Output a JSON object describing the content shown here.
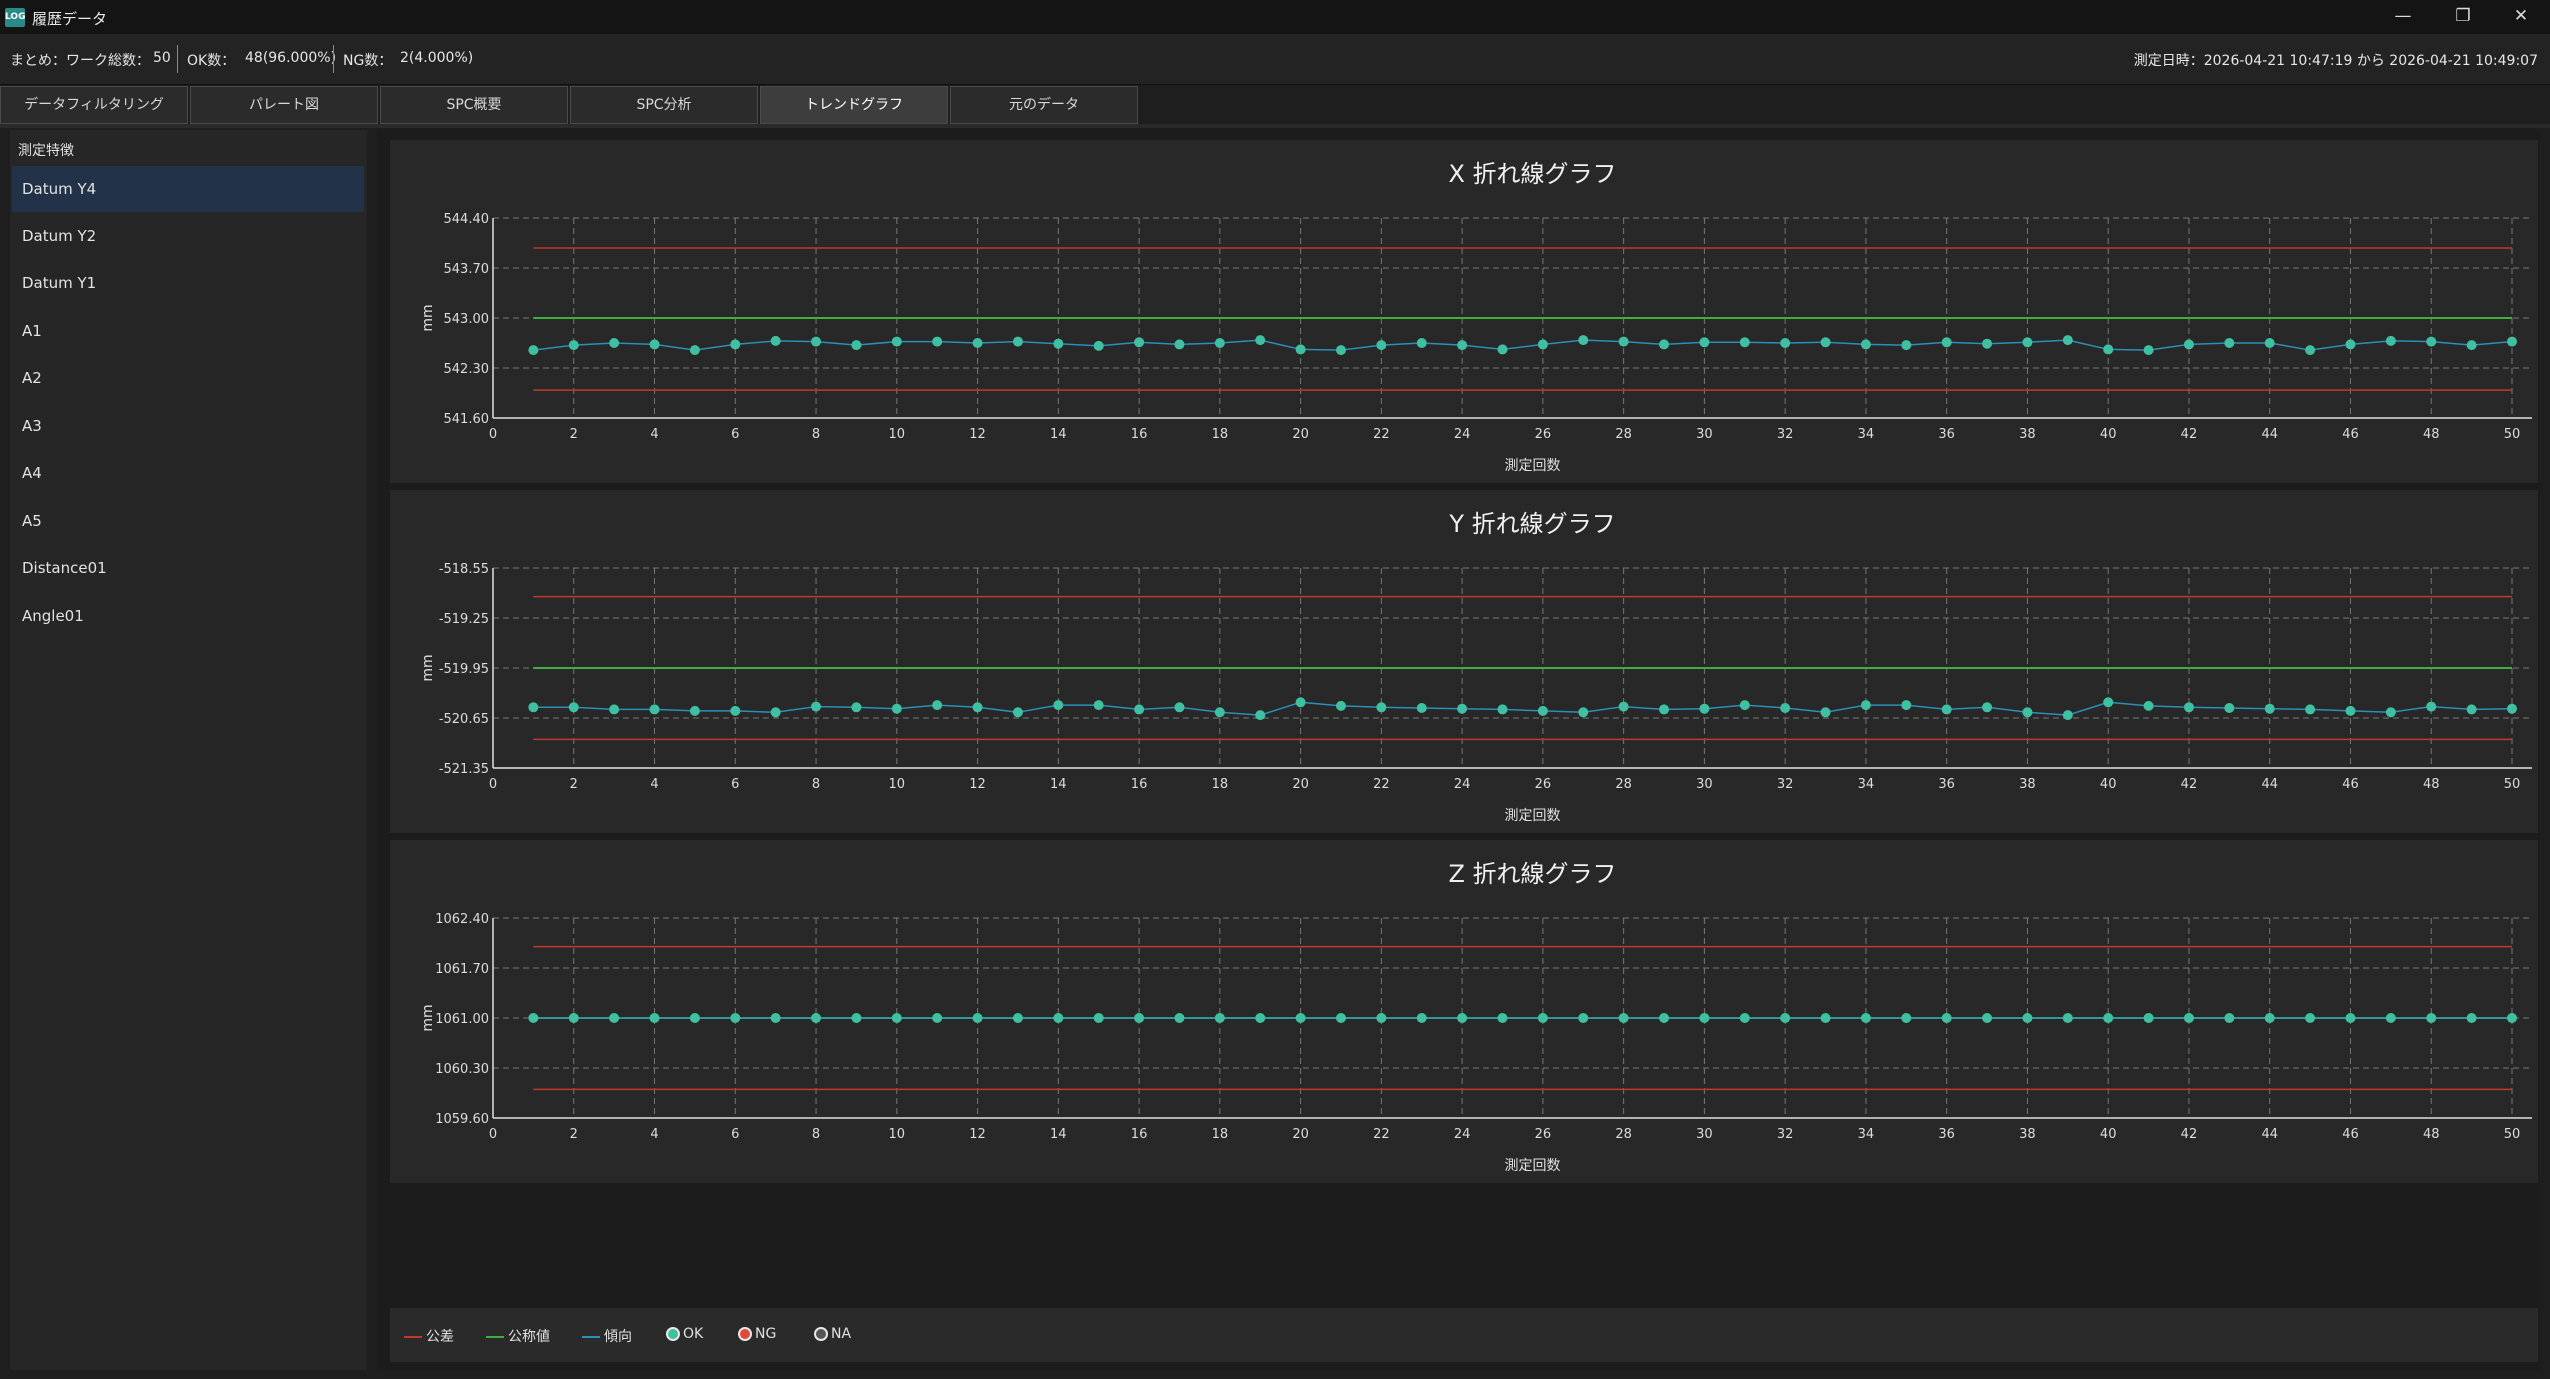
{
  "window": {
    "title": "履歴データ",
    "icon_label": "LOG",
    "min_icon": "minimize-icon",
    "restore_icon": "restore-icon",
    "close_icon": "close-icon"
  },
  "summary": {
    "prefix": "まとめ：",
    "total_label": "ワーク総数：",
    "total_value": "50",
    "ok_label": "OK数：",
    "ok_value": "48(96.000%)",
    "ng_label": "NG数：",
    "ng_value": "2(4.000%)",
    "datetime_text": "測定日時：2026-04-21 10:47:19 から 2026-04-21 10:49:07"
  },
  "tabs": [
    {
      "label": "データフィルタリング",
      "active": false
    },
    {
      "label": "パレート図",
      "active": false
    },
    {
      "label": "SPC概要",
      "active": false
    },
    {
      "label": "SPC分析",
      "active": false
    },
    {
      "label": "トレンドグラフ",
      "active": true
    },
    {
      "label": "元のデータ",
      "active": false
    }
  ],
  "sidebar": {
    "title": "測定特徴",
    "items": [
      "Datum Y4",
      "Datum Y2",
      "Datum Y1",
      "A1",
      "A2",
      "A3",
      "A4",
      "A5",
      "Distance01",
      "Angle01"
    ],
    "selected_index": 0
  },
  "colors": {
    "tolerance": "#c0392b",
    "nominal": "#3faf3f",
    "trend": "#2b8fb8",
    "ok": "#3fc0a0",
    "ng": "#e04a3a",
    "na": "#555555"
  },
  "legend": {
    "tolerance": "公差",
    "nominal": "公称値",
    "trend": "傾向",
    "ok": "OK",
    "ng": "NG",
    "na": "NA"
  },
  "chart_data": [
    {
      "type": "line",
      "title": "X 折れ線グラフ",
      "xlabel": "測定回数",
      "ylabel": "mm",
      "ylim": [
        541.6,
        544.4
      ],
      "yticks": [
        "544.40",
        "543.70",
        "543.00",
        "542.30",
        "541.60"
      ],
      "xlim": [
        0,
        50
      ],
      "xticks": [
        0,
        2,
        4,
        6,
        8,
        10,
        12,
        14,
        16,
        18,
        20,
        22,
        24,
        26,
        28,
        30,
        32,
        34,
        36,
        38,
        40,
        42,
        44,
        46,
        48,
        50
      ],
      "upper_tolerance": 543.98,
      "lower_tolerance": 541.99,
      "nominal": 543.0,
      "grid": true,
      "x": [
        1,
        2,
        3,
        4,
        5,
        6,
        7,
        8,
        9,
        10,
        11,
        12,
        13,
        14,
        15,
        16,
        17,
        18,
        19,
        20,
        21,
        22,
        23,
        24,
        25,
        26,
        27,
        28,
        29,
        30,
        31,
        32,
        33,
        34,
        35,
        36,
        37,
        38,
        39,
        40,
        41,
        42,
        43,
        44,
        45,
        46,
        47,
        48,
        49,
        50
      ],
      "values": [
        542.55,
        542.62,
        542.65,
        542.63,
        542.55,
        542.63,
        542.68,
        542.67,
        542.62,
        542.67,
        542.67,
        542.65,
        542.67,
        542.64,
        542.61,
        542.66,
        542.63,
        542.65,
        542.69,
        542.56,
        542.55,
        542.62,
        542.65,
        542.62,
        542.56,
        542.63,
        542.69,
        542.67,
        542.63,
        542.66,
        542.66,
        542.65,
        542.66,
        542.63,
        542.62,
        542.66,
        542.64,
        542.66,
        542.69,
        542.56,
        542.55,
        542.63,
        542.65,
        542.65,
        542.55,
        542.63,
        542.68,
        542.67,
        542.62,
        542.67
      ]
    },
    {
      "type": "line",
      "title": "Y 折れ線グラフ",
      "xlabel": "測定回数",
      "ylabel": "mm",
      "ylim": [
        -521.35,
        -518.55
      ],
      "yticks": [
        "-518.55",
        "-519.25",
        "-519.95",
        "-520.65",
        "-521.35"
      ],
      "xlim": [
        0,
        50
      ],
      "xticks": [
        0,
        2,
        4,
        6,
        8,
        10,
        12,
        14,
        16,
        18,
        20,
        22,
        24,
        26,
        28,
        30,
        32,
        34,
        36,
        38,
        40,
        42,
        44,
        46,
        48,
        50
      ],
      "upper_tolerance": -518.95,
      "lower_tolerance": -520.95,
      "nominal": -519.95,
      "grid": true,
      "x": [
        1,
        2,
        3,
        4,
        5,
        6,
        7,
        8,
        9,
        10,
        11,
        12,
        13,
        14,
        15,
        16,
        17,
        18,
        19,
        20,
        21,
        22,
        23,
        24,
        25,
        26,
        27,
        28,
        29,
        30,
        31,
        32,
        33,
        34,
        35,
        36,
        37,
        38,
        39,
        40,
        41,
        42,
        43,
        44,
        45,
        46,
        47,
        48,
        49,
        50
      ],
      "values": [
        -520.5,
        -520.5,
        -520.53,
        -520.53,
        -520.55,
        -520.55,
        -520.57,
        -520.49,
        -520.5,
        -520.52,
        -520.47,
        -520.5,
        -520.57,
        -520.47,
        -520.47,
        -520.53,
        -520.5,
        -520.57,
        -520.61,
        -520.43,
        -520.48,
        -520.5,
        -520.51,
        -520.52,
        -520.53,
        -520.55,
        -520.57,
        -520.49,
        -520.53,
        -520.52,
        -520.47,
        -520.51,
        -520.57,
        -520.47,
        -520.47,
        -520.53,
        -520.5,
        -520.57,
        -520.61,
        -520.43,
        -520.48,
        -520.5,
        -520.51,
        -520.52,
        -520.53,
        -520.55,
        -520.57,
        -520.49,
        -520.53,
        -520.52
      ]
    },
    {
      "type": "line",
      "title": "Z 折れ線グラフ",
      "xlabel": "測定回数",
      "ylabel": "mm",
      "ylim": [
        1059.6,
        1062.4
      ],
      "yticks": [
        "1062.40",
        "1061.70",
        "1061.00",
        "1060.30",
        "1059.60"
      ],
      "xlim": [
        0,
        50
      ],
      "xticks": [
        0,
        2,
        4,
        6,
        8,
        10,
        12,
        14,
        16,
        18,
        20,
        22,
        24,
        26,
        28,
        30,
        32,
        34,
        36,
        38,
        40,
        42,
        44,
        46,
        48,
        50
      ],
      "upper_tolerance": 1062.0,
      "lower_tolerance": 1060.0,
      "nominal": 1061.0,
      "grid": true,
      "x": [
        1,
        2,
        3,
        4,
        5,
        6,
        7,
        8,
        9,
        10,
        11,
        12,
        13,
        14,
        15,
        16,
        17,
        18,
        19,
        20,
        21,
        22,
        23,
        24,
        25,
        26,
        27,
        28,
        29,
        30,
        31,
        32,
        33,
        34,
        35,
        36,
        37,
        38,
        39,
        40,
        41,
        42,
        43,
        44,
        45,
        46,
        47,
        48,
        49,
        50
      ],
      "values": [
        1061.0,
        1061.0,
        1061.0,
        1061.0,
        1061.0,
        1061.0,
        1061.0,
        1061.0,
        1061.0,
        1061.0,
        1061.0,
        1061.0,
        1061.0,
        1061.0,
        1061.0,
        1061.0,
        1061.0,
        1061.0,
        1061.0,
        1061.0,
        1061.0,
        1061.0,
        1061.0,
        1061.0,
        1061.0,
        1061.0,
        1061.0,
        1061.0,
        1061.0,
        1061.0,
        1061.0,
        1061.0,
        1061.0,
        1061.0,
        1061.0,
        1061.0,
        1061.0,
        1061.0,
        1061.0,
        1061.0,
        1061.0,
        1061.0,
        1061.0,
        1061.0,
        1061.0,
        1061.0,
        1061.0,
        1061.0,
        1061.0,
        1061.0
      ]
    }
  ]
}
